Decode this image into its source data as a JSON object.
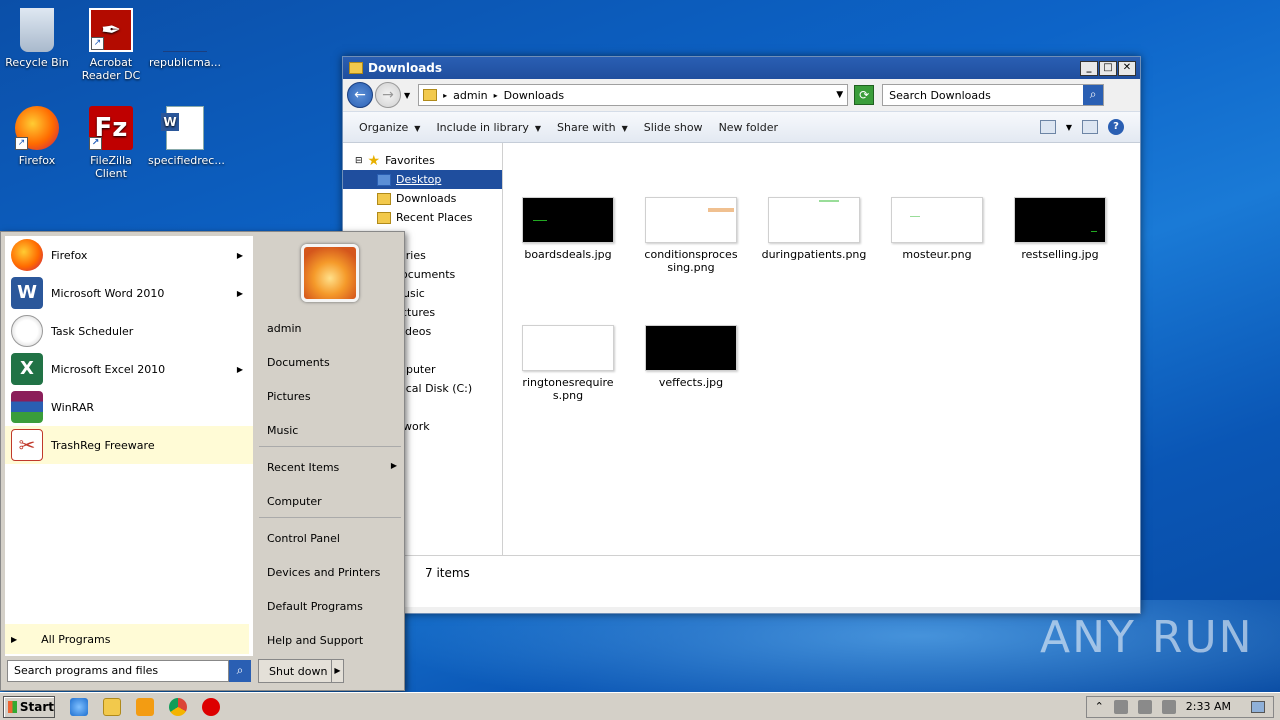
{
  "desktop": {
    "icons": [
      {
        "label": "Recycle Bin"
      },
      {
        "label": "Acrobat Reader DC"
      },
      {
        "label": "republicma..."
      },
      {
        "label": "Firefox"
      },
      {
        "label": "FileZilla Client"
      },
      {
        "label": "specifiedrec..."
      }
    ],
    "watermark": "ANY RUN"
  },
  "explorer": {
    "title": "Downloads",
    "breadcrumb": [
      "admin",
      "Downloads"
    ],
    "search_placeholder": "Search Downloads",
    "toolbar": {
      "organize": "Organize",
      "include_library": "Include in library",
      "share_with": "Share with",
      "slide_show": "Slide show",
      "new_folder": "New folder"
    },
    "nav": {
      "favorites": "Favorites",
      "desktop": "Desktop",
      "downloads": "Downloads",
      "recent_places": "Recent Places",
      "libraries": "aries",
      "documents": "ocuments",
      "music": "usic",
      "pictures": "ctures",
      "videos": "deos",
      "computer": "nputer",
      "local_disk": "ocal Disk (C:)",
      "network": "work"
    },
    "files": [
      {
        "name": "boardsdeals.jpg",
        "thumb": "black"
      },
      {
        "name": "conditionsprocessing.png",
        "thumb": "white"
      },
      {
        "name": "duringpatients.png",
        "thumb": "white"
      },
      {
        "name": "mosteur.png",
        "thumb": "white"
      },
      {
        "name": "restselling.jpg",
        "thumb": "black"
      },
      {
        "name": "ringtonesrequires.png",
        "thumb": "white"
      },
      {
        "name": "veffects.jpg",
        "thumb": "black"
      }
    ],
    "status": "7 items"
  },
  "start_menu": {
    "programs": [
      {
        "label": "Firefox",
        "color": "#e8702a"
      },
      {
        "label": "Microsoft Word 2010",
        "color": "#2b579a"
      },
      {
        "label": "Task Scheduler",
        "color": "#c8c8c8"
      },
      {
        "label": "Microsoft Excel 2010",
        "color": "#217346"
      },
      {
        "label": "WinRAR",
        "color": "#8b1e5a"
      },
      {
        "label": "TrashReg Freeware",
        "color": "#c0392b"
      }
    ],
    "all_programs": "All Programs",
    "search_placeholder": "Search programs and files",
    "right": {
      "user": "admin",
      "documents": "Documents",
      "pictures": "Pictures",
      "music": "Music",
      "recent_items": "Recent Items",
      "computer": "Computer",
      "control_panel": "Control Panel",
      "devices_printers": "Devices and Printers",
      "default_programs": "Default Programs",
      "help_support": "Help and Support"
    },
    "shutdown": "Shut down"
  },
  "taskbar": {
    "start": "Start",
    "time": "2:33 AM"
  }
}
